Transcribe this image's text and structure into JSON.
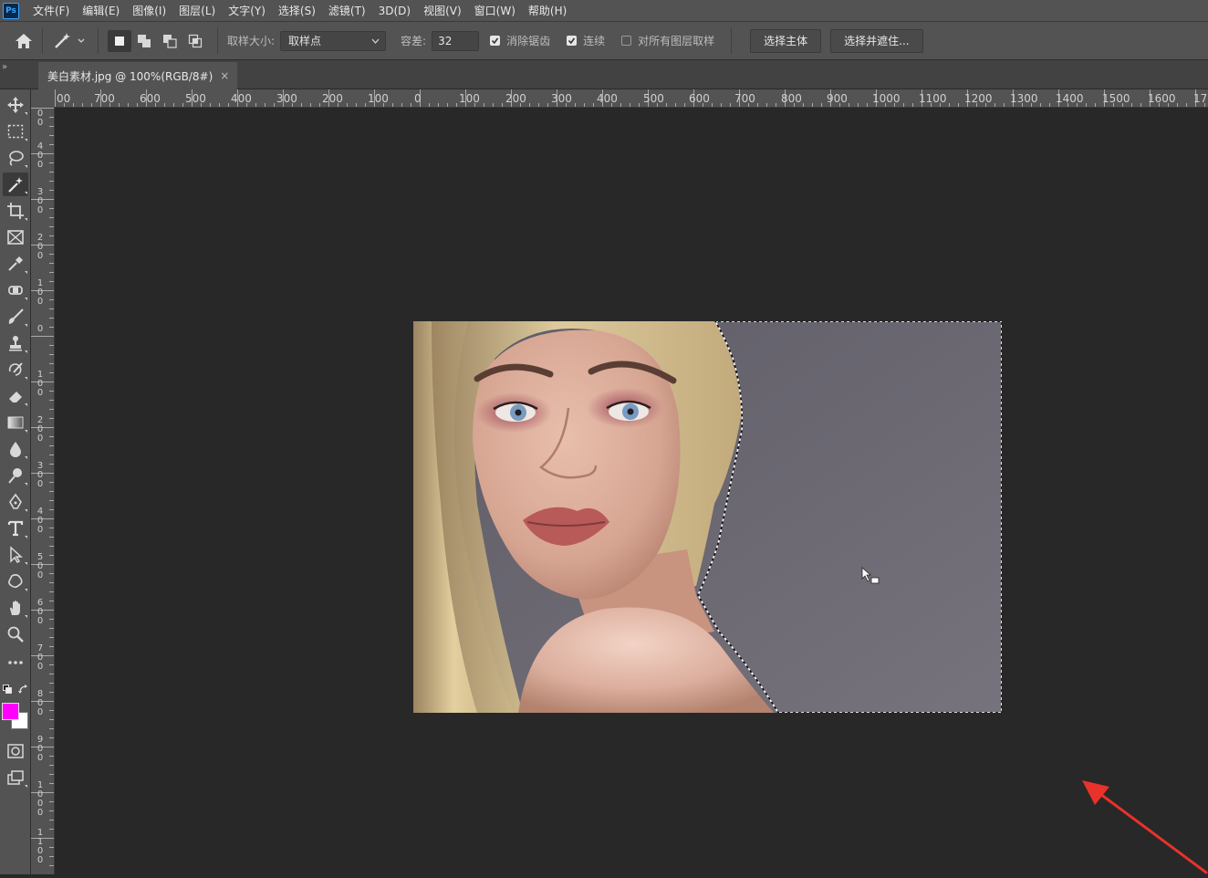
{
  "app": {
    "logo": "Ps"
  },
  "menu": [
    "文件(F)",
    "编辑(E)",
    "图像(I)",
    "图层(L)",
    "文字(Y)",
    "选择(S)",
    "滤镜(T)",
    "3D(D)",
    "视图(V)",
    "窗口(W)",
    "帮助(H)"
  ],
  "options": {
    "sample_size_label": "取样大小:",
    "sample_size_value": "取样点",
    "tolerance_label": "容差:",
    "tolerance_value": "32",
    "anti_alias_label": "消除锯齿",
    "anti_alias_checked": true,
    "contiguous_label": "连续",
    "contiguous_checked": true,
    "sample_all_layers_label": "对所有图层取样",
    "sample_all_layers_checked": false,
    "select_subject_label": "选择主体",
    "select_mask_label": "选择并遮住..."
  },
  "tabs": {
    "collapse_label": "»",
    "doc_title": "美白素材.jpg @ 100%(RGB/8#)",
    "close_label": "×"
  },
  "ruler": {
    "h_labels": [
      "00",
      "700",
      "600",
      "500",
      "400",
      "300",
      "200",
      "100",
      "0",
      "100",
      "200",
      "300",
      "400",
      "500",
      "600",
      "700",
      "800",
      "900",
      "1000",
      "1100",
      "1200",
      "1300",
      "1400",
      "1500",
      "1600",
      "17"
    ],
    "v_labels": [
      "0 0",
      "4 0 0",
      "3 0 0",
      "2 0 0",
      "1 0 0",
      "0",
      "1 0 0",
      "2 0 0",
      "3 0 0",
      "4 0 0",
      "5 0 0",
      "6 0 0",
      "7 0 0",
      "8 0 0",
      "9 0 0",
      "1 0 0 0",
      "1 1 0 0"
    ]
  },
  "tools": [
    "move-tool",
    "marquee-tool",
    "lasso-tool",
    "magic-wand-tool",
    "crop-tool",
    "frame-tool",
    "eyedropper-tool",
    "spot-healing-tool",
    "brush-tool",
    "clone-stamp-tool",
    "history-brush-tool",
    "eraser-tool",
    "gradient-tool",
    "blur-tool",
    "dodge-tool",
    "pen-tool",
    "type-tool",
    "path-selection-tool",
    "custom-shape-tool",
    "hand-tool",
    "zoom-tool",
    "more-tools"
  ],
  "colors": {
    "foreground": "#ff00ff",
    "background": "#ffffff",
    "annotation": "#e8322a",
    "backdrop": "#6a6871"
  }
}
